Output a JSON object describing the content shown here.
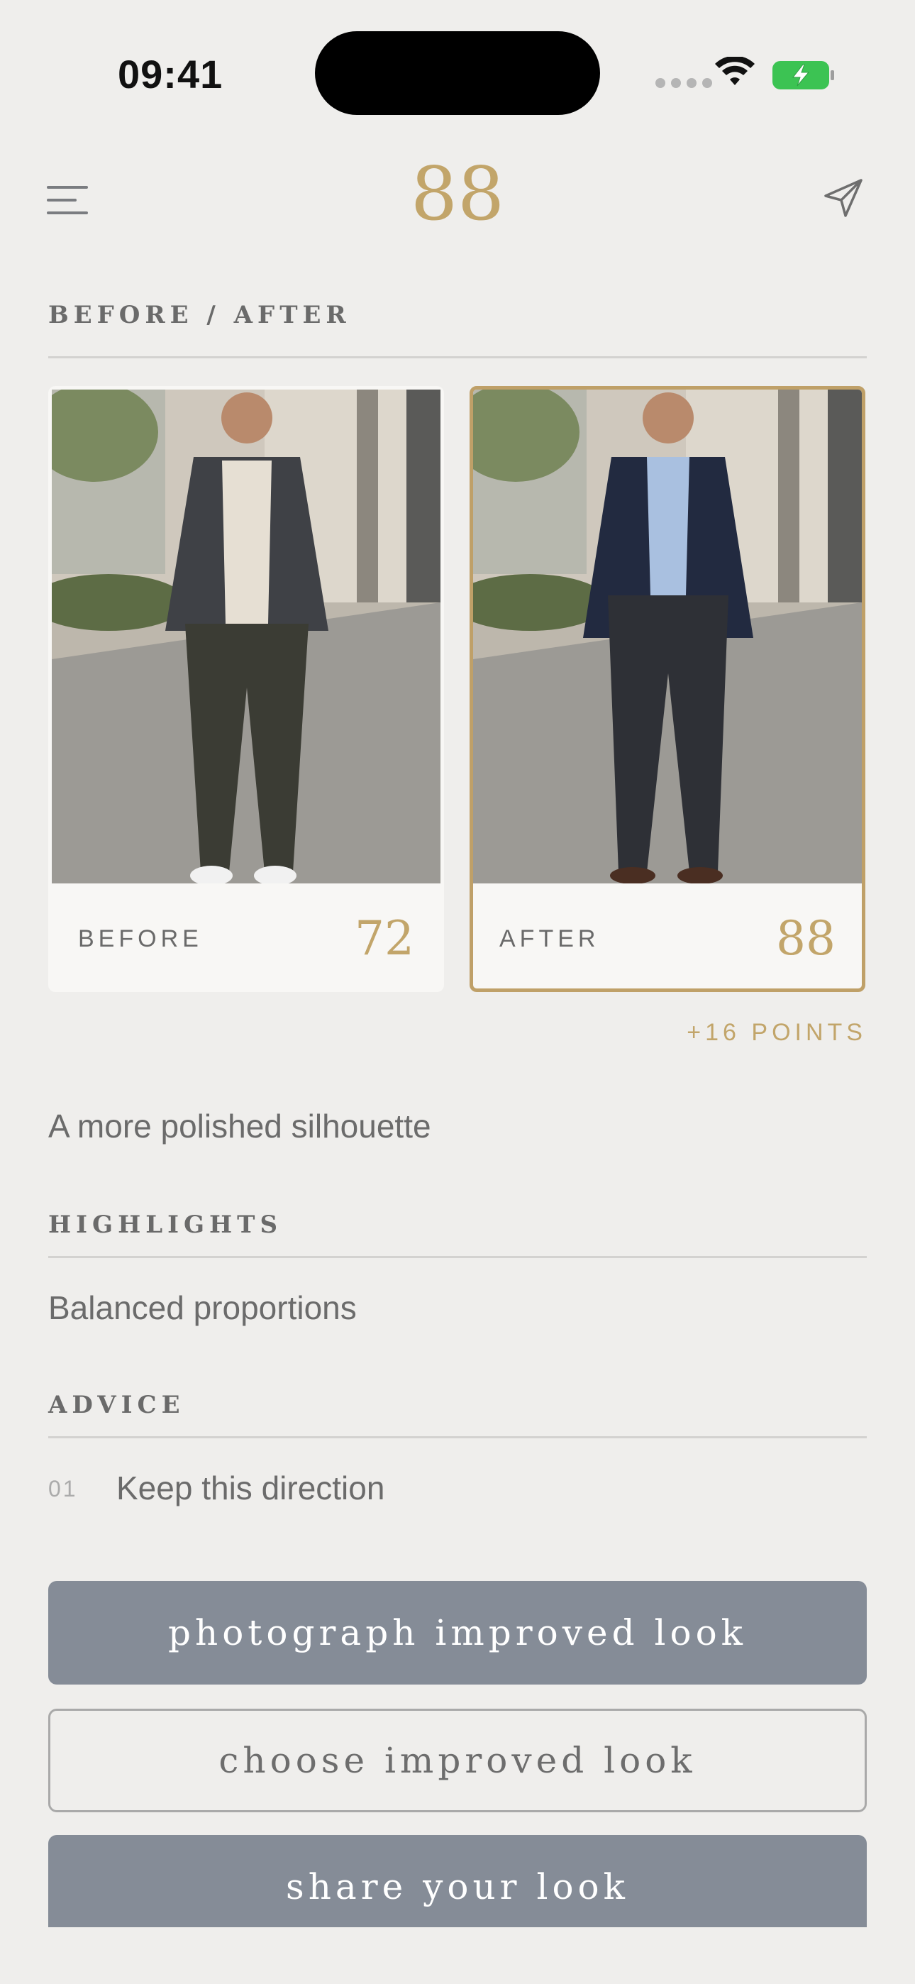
{
  "status_bar": {
    "time": "09:41"
  },
  "header": {
    "score": "88"
  },
  "before_after": {
    "section_title": "BEFORE / AFTER",
    "before": {
      "label": "BEFORE",
      "score": "72"
    },
    "after": {
      "label": "AFTER",
      "score": "88"
    },
    "delta": "+16 POINTS"
  },
  "headline": "A more polished silhouette",
  "highlights": {
    "title": "HIGHLIGHTS",
    "items": [
      "Balanced proportions"
    ]
  },
  "advice": {
    "title": "ADVICE",
    "items": [
      {
        "num": "01",
        "text": "Keep this direction"
      }
    ]
  },
  "buttons": {
    "photograph": "photograph improved look",
    "choose": "choose improved look",
    "share": "share your look"
  },
  "colors": {
    "accent": "#C2A56A",
    "button": "#858C97",
    "background": "#EFEEEC"
  }
}
